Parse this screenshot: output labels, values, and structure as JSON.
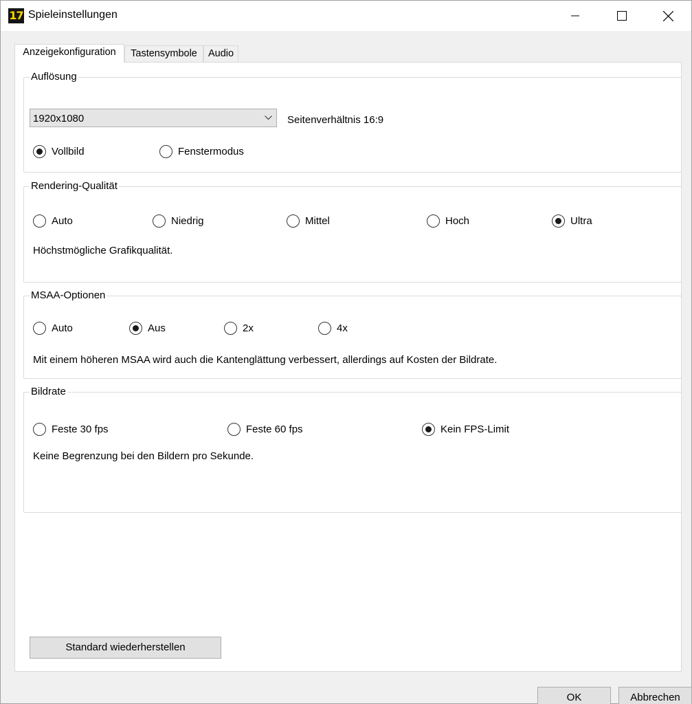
{
  "window": {
    "icon_text": "17",
    "title": "Spieleinstellungen"
  },
  "tabs": [
    {
      "label": "Anzeigekonfiguration",
      "active": true
    },
    {
      "label": "Tastensymbole",
      "active": false
    },
    {
      "label": "Audio",
      "active": false
    }
  ],
  "resolution": {
    "label": "Auflösung",
    "selected": "1920x1080",
    "aspect": "Seitenverhältnis 16:9",
    "modes": [
      {
        "label": "Vollbild",
        "checked": true
      },
      {
        "label": "Fenstermodus",
        "checked": false
      }
    ]
  },
  "rendering": {
    "label": "Rendering-Qualität",
    "options": [
      {
        "label": "Auto",
        "checked": false
      },
      {
        "label": "Niedrig",
        "checked": false
      },
      {
        "label": "Mittel",
        "checked": false
      },
      {
        "label": "Hoch",
        "checked": false
      },
      {
        "label": "Ultra",
        "checked": true
      }
    ],
    "description": "Höchstmögliche Grafikqualität."
  },
  "msaa": {
    "label": "MSAA-Optionen",
    "options": [
      {
        "label": "Auto",
        "checked": false
      },
      {
        "label": "Aus",
        "checked": true
      },
      {
        "label": "2x",
        "checked": false
      },
      {
        "label": "4x",
        "checked": false
      }
    ],
    "description": "Mit einem höheren MSAA wird auch die Kantenglättung verbessert, allerdings auf Kosten der Bildrate."
  },
  "framerate": {
    "label": "Bildrate",
    "options": [
      {
        "label": "Feste 30 fps",
        "checked": false
      },
      {
        "label": "Feste 60 fps",
        "checked": false
      },
      {
        "label": "Kein FPS-Limit",
        "checked": true
      }
    ],
    "description": "Keine Begrenzung bei den Bildern pro Sekunde."
  },
  "buttons": {
    "reset": "Standard wiederherstellen",
    "ok": "OK",
    "cancel": "Abbrechen"
  }
}
